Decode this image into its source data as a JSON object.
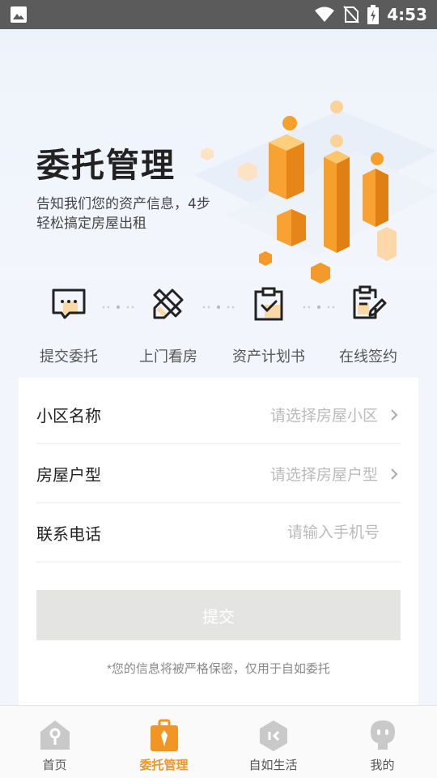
{
  "status_bar": {
    "time": "4:53"
  },
  "hero": {
    "title": "委托管理",
    "description": "告知我们您的资产信息，4步轻松搞定房屋出租"
  },
  "steps": [
    {
      "label": "提交委托",
      "icon": "chat-bubble-icon"
    },
    {
      "label": "上门看房",
      "icon": "pencil-ruler-icon"
    },
    {
      "label": "资产计划书",
      "icon": "clipboard-check-icon"
    },
    {
      "label": "在线签约",
      "icon": "sign-document-icon"
    }
  ],
  "form": {
    "community": {
      "label": "小区名称",
      "placeholder": "请选择房屋小区"
    },
    "layout": {
      "label": "房屋户型",
      "placeholder": "请选择房屋户型"
    },
    "phone": {
      "label": "联系电话",
      "placeholder": "请输入手机号"
    },
    "submit_label": "提交",
    "privacy_note": "*您的信息将被严格保密，仅用于自如委托"
  },
  "bottom_nav": [
    {
      "label": "首页",
      "icon": "home-icon",
      "active": false
    },
    {
      "label": "委托管理",
      "icon": "briefcase-icon",
      "active": true
    },
    {
      "label": "自如生活",
      "icon": "life-icon",
      "active": false
    },
    {
      "label": "我的",
      "icon": "profile-icon",
      "active": false
    }
  ],
  "colors": {
    "accent": "#f19624",
    "button_disabled": "#e4e4e2"
  }
}
